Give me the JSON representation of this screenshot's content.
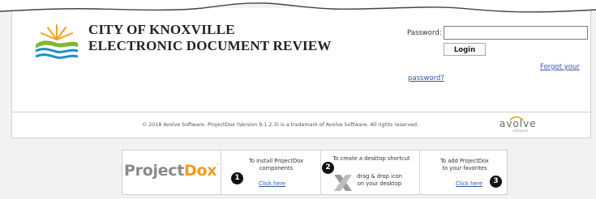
{
  "header": {
    "title_line1": "CITY OF KNOXVILLE",
    "title_line2": "ELECTRONIC DOCUMENT REVIEW"
  },
  "login": {
    "password_label": "Password:",
    "login_button": "Login",
    "forgot_line1": "Forgot your",
    "forgot_line2": "password?"
  },
  "footer": {
    "copyright": "© 2018 Avolve Software. ProjectDox (Version 9.1.2.3) is a trademark of Avolve Software. All rights reserved.",
    "avolve_logo": "avolve",
    "avolve_sub": "software"
  },
  "strip": {
    "logo_project": "Project",
    "logo_dox": "Dox",
    "install": {
      "line1": "To install ProjectDox",
      "line2": "components",
      "link": "Click here",
      "num": "1"
    },
    "shortcut": {
      "line1": "To create a desktop shortcut",
      "line2": "drag & drop icon",
      "line3": "on your desktop",
      "num": "2"
    },
    "favorites": {
      "line1": "To add ProjectDox",
      "line2": "to your favorites",
      "link": "Click here",
      "num": "3"
    }
  },
  "colors": {
    "dox_orange": "#f29b1e",
    "link_blue": "#3355aa",
    "logo_gray": "#8a8a8a"
  }
}
